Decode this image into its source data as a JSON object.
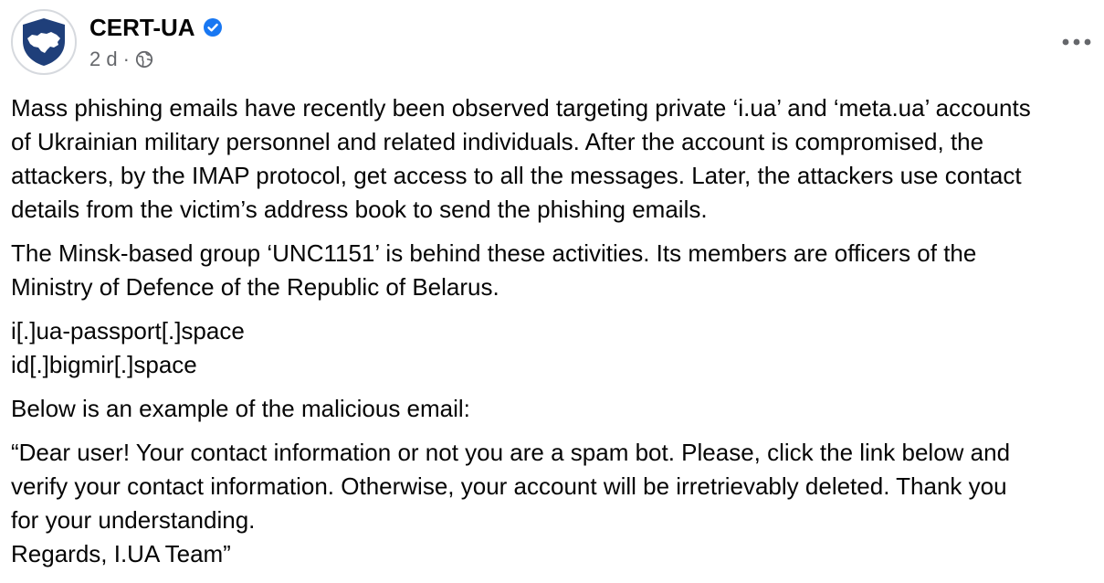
{
  "post": {
    "author": "CERT-UA",
    "timestamp": "2 d",
    "separator": "·",
    "audience_icon": "globe-icon",
    "more_icon": "more-options-icon",
    "avatar_icon": "shield-map-icon",
    "verified_icon": "verified-badge-icon",
    "colors": {
      "verified": "#1877f2",
      "avatar_shield": "#1f3f7a",
      "secondary_text": "#65676b",
      "text": "#050505"
    },
    "paragraphs": [
      "Mass phishing emails have recently been observed targeting private ‘i.ua’ and ‘meta.ua’ accounts\nof Ukrainian military personnel and related individuals. After the account is compromised, the\nattackers, by the IMAP protocol, get access to all the messages. Later, the attackers use contact\ndetails from the victim’s address book to send the phishing emails.",
      "The Minsk-based group ‘UNC1151’ is behind these activities. Its members are officers of the\nMinistry of Defence of the Republic of Belarus."
    ],
    "domains": [
      "i[.]ua-passport[.]space",
      "id[.]bigmir[.]space"
    ],
    "intro": "Below is an example of the malicious email:",
    "quote": "“Dear user! Your contact information or not you are a spam bot. Please, click the link below and\nverify your contact information. Otherwise, your account will be irretrievably deleted. Thank you\nfor your understanding.\nRegards, I.UA Team”"
  }
}
